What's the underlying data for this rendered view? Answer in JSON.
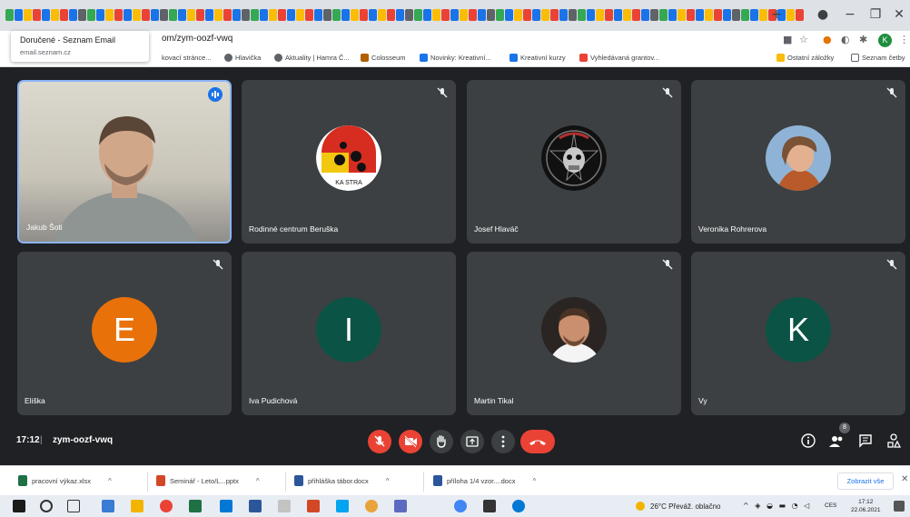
{
  "browser": {
    "tooltip": {
      "title": "Doručené - Seznam Email",
      "subtitle": "email.seznam.cz"
    },
    "url": "om/zym-oozf-vwq",
    "bookmarks": [
      "kovací stránce...",
      "Hlavička",
      "Aktuality | Hamra Č...",
      "Colosseum",
      "Novinky: Kreativní...",
      "Kreativní kurzy",
      "Vyhledávaná grantov..."
    ],
    "other_bookmarks": "Ostatní záložky",
    "reading_list": "Seznam četby",
    "profile_initial": "K",
    "new_tab_symbol": "+"
  },
  "participants": [
    {
      "name": "Jakub Šoti",
      "type": "video"
    },
    {
      "name": "Rodinné centrum Beruška",
      "type": "image",
      "icon": "ladybug-logo-avatar"
    },
    {
      "name": "Josef Hlaváč",
      "type": "image",
      "icon": "skull-pentagram-avatar"
    },
    {
      "name": "Veronika Rohrerova",
      "type": "image",
      "icon": "woman-photo-avatar"
    },
    {
      "name": "Eliška",
      "type": "letter",
      "letter": "E",
      "color": "#e8710a"
    },
    {
      "name": "Iva Pudichová",
      "type": "letter",
      "letter": "I",
      "color": "#0b5345"
    },
    {
      "name": "Martin Tikal",
      "type": "image",
      "icon": "man-photo-avatar"
    },
    {
      "name": "Vy",
      "type": "letter",
      "letter": "K",
      "color": "#0b5345"
    }
  ],
  "meeting": {
    "time": "17:12",
    "separator": "|",
    "code": "zym-oozf-vwq",
    "people_count": "8"
  },
  "downloads": [
    {
      "name": "pracovní výkaz.xlsx",
      "icon_color": "#1e7145"
    },
    {
      "name": "Seminář - Leto/L...pptx",
      "icon_color": "#d24726"
    },
    {
      "name": "přihláška tábor.docx",
      "icon_color": "#2b579a"
    },
    {
      "name": "příloha 1/4 vzor....docx",
      "icon_color": "#2b579a"
    }
  ],
  "downloads_show_all": "Zobrazit vše",
  "taskbar": {
    "weather": "26°C  Převáž. oblačno",
    "lang": "CES",
    "time": "17:12",
    "date": "22.06.2021"
  },
  "colors": {
    "meet_bg": "#202124",
    "tile_bg": "#3c4043",
    "danger": "#ea4335",
    "accent": "#1a73e8"
  }
}
